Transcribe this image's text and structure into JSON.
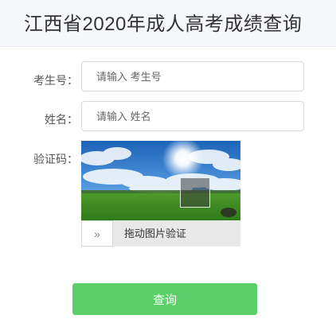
{
  "header": {
    "title": "江西省2020年成人高考成绩查询"
  },
  "form": {
    "exam_id": {
      "label": "考生号：",
      "placeholder": "请输入 考生号"
    },
    "name": {
      "label": "姓名：",
      "placeholder": "请输入 姓名"
    },
    "captcha": {
      "label": "验证码：",
      "slider_icon": "double-chevron-right-icon",
      "slider_handle_glyph": "»",
      "slider_text": "拖动图片验证"
    },
    "submit_label": "查询"
  },
  "colors": {
    "header_bg": "#f5f7fa",
    "button_bg": "#5ccf6a",
    "slider_bg": "#e8e8e8"
  }
}
